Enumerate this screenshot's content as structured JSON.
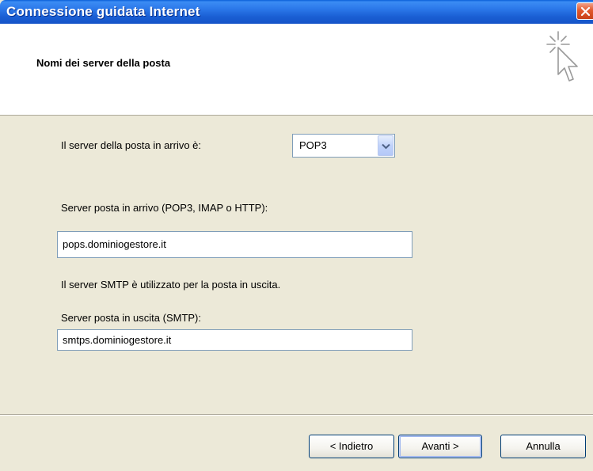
{
  "window": {
    "title": "Connessione guidata Internet"
  },
  "header": {
    "title": "Nomi dei server della posta"
  },
  "form": {
    "incoming_type_label": "Il server della posta in arrivo è:",
    "incoming_type_value": "POP3",
    "incoming_server_label": "Server posta in arrivo (POP3, IMAP o HTTP):",
    "incoming_server_value": "pops.dominiogestore.it",
    "smtp_info": "Il server SMTP è utilizzato per la posta in uscita.",
    "outgoing_server_label": "Server posta in uscita (SMTP):",
    "outgoing_server_value": "smtps.dominiogestore.it"
  },
  "buttons": {
    "back": "< Indietro",
    "next": "Avanti >",
    "cancel": "Annulla"
  },
  "icons": {
    "close": "close-icon",
    "wizard": "wizard-cursor-icon",
    "dropdown": "chevron-down-icon"
  },
  "colors": {
    "titlebar": "#2a76e8",
    "close_button": "#e1582c",
    "dialog_background": "#ece9d8",
    "field_border": "#7f9db9"
  }
}
